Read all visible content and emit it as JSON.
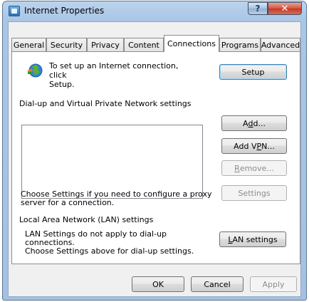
{
  "window": {
    "title": "Internet Properties",
    "help_label": "?",
    "close_label": "✕"
  },
  "tabs": [
    {
      "label": "General",
      "active": false
    },
    {
      "label": "Security",
      "active": false
    },
    {
      "label": "Privacy",
      "active": false
    },
    {
      "label": "Content",
      "active": false
    },
    {
      "label": "Connections",
      "active": true
    },
    {
      "label": "Programs",
      "active": false
    },
    {
      "label": "Advanced",
      "active": false
    }
  ],
  "connections": {
    "intro_text": "To set up an Internet connection, click\nSetup.",
    "setup_button": "Setup",
    "dialup_group_label": "Dial-up and Virtual Private Network settings",
    "add_button": {
      "pre": "A",
      "accel": "d",
      "post": "d..."
    },
    "add_vpn_button": {
      "pre": "Add V",
      "accel": "P",
      "post": "N..."
    },
    "remove_button": {
      "pre": "",
      "accel": "R",
      "post": "emove..."
    },
    "settings_button": "Settings",
    "proxy_text": "Choose Settings if you need to configure a proxy\nserver for a connection.",
    "lan_group_label": "Local Area Network (LAN) settings",
    "lan_text": "LAN Settings do not apply to dial-up connections.\nChoose Settings above for dial-up settings.",
    "lan_button": {
      "pre": "",
      "accel": "L",
      "post": "AN settings"
    }
  },
  "footer": {
    "ok_button": "OK",
    "cancel_button": "Cancel",
    "apply_button": "Apply"
  },
  "colors": {
    "title_frame": "#a9c6e6",
    "close_red": "#c23a26",
    "default_button_border": "#3c7fb1"
  }
}
